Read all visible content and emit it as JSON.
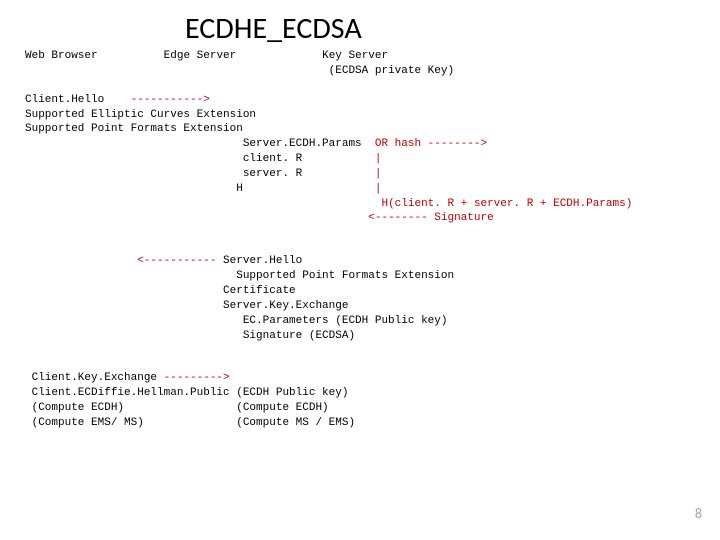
{
  "title": "ECDHE_ECDSA",
  "header": {
    "col1": "Web Browser",
    "col2": "Edge Server",
    "col3a": "Key Server",
    "col3b": "(ECDSA private Key)"
  },
  "block1": {
    "l1a": "Client.Hello    ",
    "l1b": "----------->",
    "l2": "Supported Elliptic Curves Extension",
    "l3": "Supported Point Formats Extension",
    "l4a": "                                 Server.ECDH.Params  ",
    "l4b": "OR hash -------->",
    "l5a": "                                 client. R           ",
    "l5b": "|",
    "l6a": "                                 server. R           ",
    "l6b": "|",
    "l7a": "                                H                    ",
    "l7b": "|",
    "l8a": "                                                      ",
    "l8b": "H(client. R + server. R + ECDH.Params)",
    "l9a": "                                                    ",
    "l9b": "<-------- Signature"
  },
  "block2": {
    "l1a": "                 ",
    "l1b": "<-----------",
    "l1c": " Server.Hello",
    "l2": "                                Supported Point Formats Extension",
    "l3": "                              Certificate",
    "l4": "                              Server.Key.Exchange",
    "l5": "                                 EC.Parameters (ECDH Public key)",
    "l6": "                                 Signature (ECDSA)"
  },
  "block3": {
    "l1a": " Client.Key.Exchange ",
    "l1b": "--------->",
    "l2": " Client.ECDiffie.Hellman.Public (ECDH Public key)",
    "l3": " (Compute ECDH)                 (Compute ECDH)",
    "l4": " (Compute EMS/ MS)              (Compute MS / EMS)"
  },
  "pagenum": "8"
}
